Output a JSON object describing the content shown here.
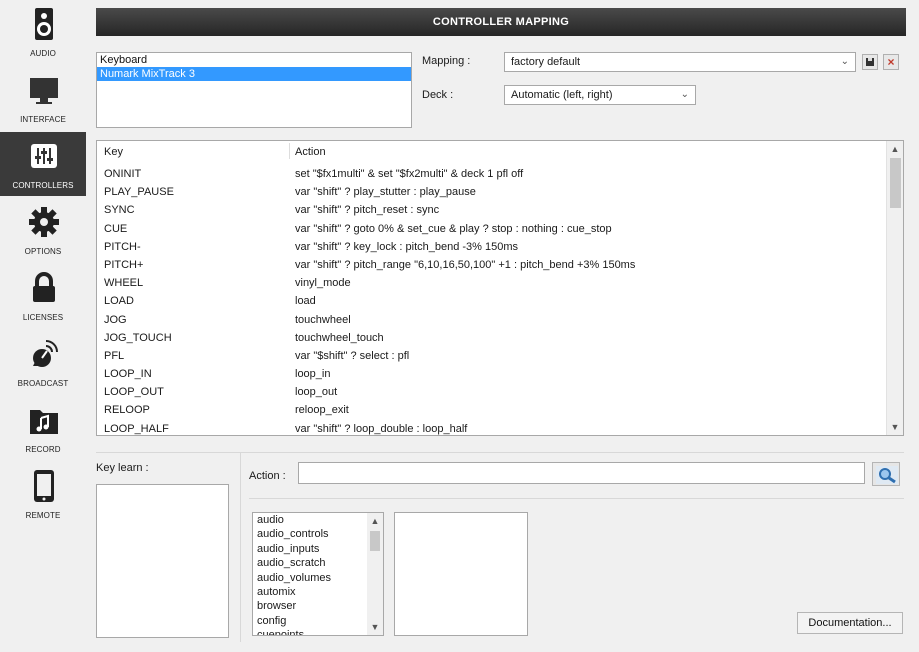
{
  "sidebar": {
    "items": [
      {
        "label": "AUDIO",
        "icon": "speaker-icon"
      },
      {
        "label": "INTERFACE",
        "icon": "monitor-icon"
      },
      {
        "label": "CONTROLLERS",
        "icon": "sliders-icon",
        "active": true
      },
      {
        "label": "OPTIONS",
        "icon": "gear-icon"
      },
      {
        "label": "LICENSES",
        "icon": "lock-icon"
      },
      {
        "label": "BROADCAST",
        "icon": "broadcast-dish-icon"
      },
      {
        "label": "RECORD",
        "icon": "music-folder-icon"
      },
      {
        "label": "REMOTE",
        "icon": "tablet-icon"
      }
    ]
  },
  "header": {
    "title": "CONTROLLER MAPPING"
  },
  "devices": [
    "Keyboard",
    "Numark MixTrack 3"
  ],
  "mapping": {
    "label": "Mapping :",
    "value": "factory default"
  },
  "deck": {
    "label": "Deck :",
    "value": "Automatic (left, right)"
  },
  "table": {
    "col_key": "Key",
    "col_action": "Action",
    "rows": [
      {
        "key": "ONINIT",
        "action": "set \"$fx1multi\" & set \"$fx2multi\" & deck 1 pfl off"
      },
      {
        "key": "PLAY_PAUSE",
        "action": "var \"shift\" ? play_stutter : play_pause"
      },
      {
        "key": "SYNC",
        "action": "var \"shift\" ? pitch_reset : sync"
      },
      {
        "key": "CUE",
        "action": "var \"shift\" ? goto 0% & set_cue & play ? stop : nothing : cue_stop"
      },
      {
        "key": "PITCH-",
        "action": "var \"shift\" ? key_lock : pitch_bend -3% 150ms"
      },
      {
        "key": "PITCH+",
        "action": "var \"shift\" ? pitch_range \"6,10,16,50,100\" +1 : pitch_bend +3% 150ms"
      },
      {
        "key": "WHEEL",
        "action": "vinyl_mode"
      },
      {
        "key": "LOAD",
        "action": "load"
      },
      {
        "key": "JOG",
        "action": "touchwheel"
      },
      {
        "key": "JOG_TOUCH",
        "action": "touchwheel_touch"
      },
      {
        "key": "PFL",
        "action": "var \"$shift\" ? select : pfl"
      },
      {
        "key": "LOOP_IN",
        "action": "loop_in"
      },
      {
        "key": "LOOP_OUT",
        "action": "loop_out"
      },
      {
        "key": "RELOOP",
        "action": "reloop_exit"
      },
      {
        "key": "LOOP_HALF",
        "action": "var \"shift\" ? loop_double : loop_half"
      }
    ]
  },
  "keylearn": {
    "label": "Key learn :"
  },
  "action": {
    "label": "Action :",
    "value": ""
  },
  "categories": [
    "audio",
    "audio_controls",
    "audio_inputs",
    "audio_scratch",
    "audio_volumes",
    "automix",
    "browser",
    "config",
    "cuepoints"
  ],
  "documentation_button": "Documentation..."
}
